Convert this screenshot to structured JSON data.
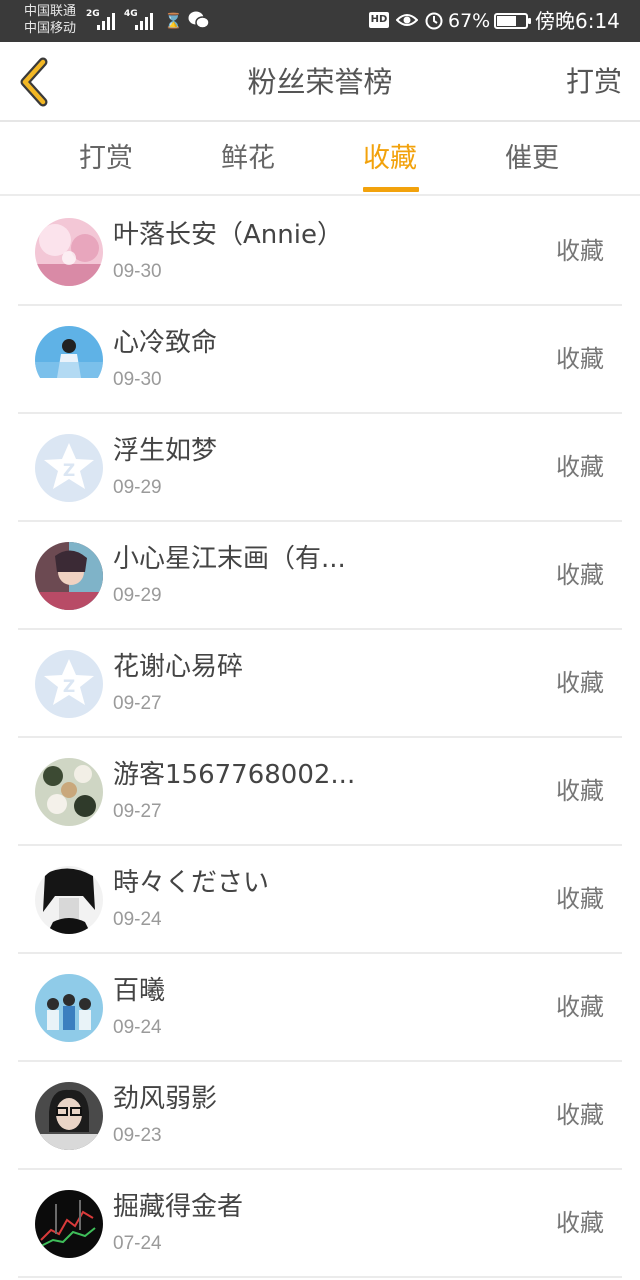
{
  "status_bar": {
    "carrier_1": "中国联通",
    "carrier_2": "中国移动",
    "net_1": "2G",
    "net_2": "4G",
    "battery_text": "67%",
    "battery_level": 0.67,
    "time": "傍晚6:14",
    "hd_label": "HD",
    "icons": [
      "signal-icon",
      "hourglass-icon",
      "wechat-icon",
      "eye-icon",
      "alarm-icon",
      "battery-icon"
    ]
  },
  "header": {
    "title": "粉丝荣誉榜",
    "action": "打赏",
    "back_icon": "chevron-left-icon"
  },
  "tabs": [
    {
      "label": "打赏",
      "active": false
    },
    {
      "label": "鲜花",
      "active": false
    },
    {
      "label": "收藏",
      "active": true
    },
    {
      "label": "催更",
      "active": false
    }
  ],
  "colors": {
    "accent": "#f2a20c",
    "status_bar": "#3a3a3a"
  },
  "list": [
    {
      "name": "叶落长安（Annie）",
      "date": "09-30",
      "tag": "收藏"
    },
    {
      "name": "心冷致命",
      "date": "09-30",
      "tag": "收藏"
    },
    {
      "name": "浮生如梦",
      "date": "09-29",
      "tag": "收藏"
    },
    {
      "name": "小心星江末画（有...",
      "date": "09-29",
      "tag": "收藏"
    },
    {
      "name": "花谢心易碎",
      "date": "09-27",
      "tag": "收藏"
    },
    {
      "name": "游客1567768002...",
      "date": "09-27",
      "tag": "收藏"
    },
    {
      "name": "時々ください",
      "date": "09-24",
      "tag": "收藏"
    },
    {
      "name": "百曦",
      "date": "09-24",
      "tag": "收藏"
    },
    {
      "name": "劲风弱影",
      "date": "09-23",
      "tag": "收藏"
    },
    {
      "name": "掘藏得金者",
      "date": "07-24",
      "tag": "收藏"
    }
  ]
}
